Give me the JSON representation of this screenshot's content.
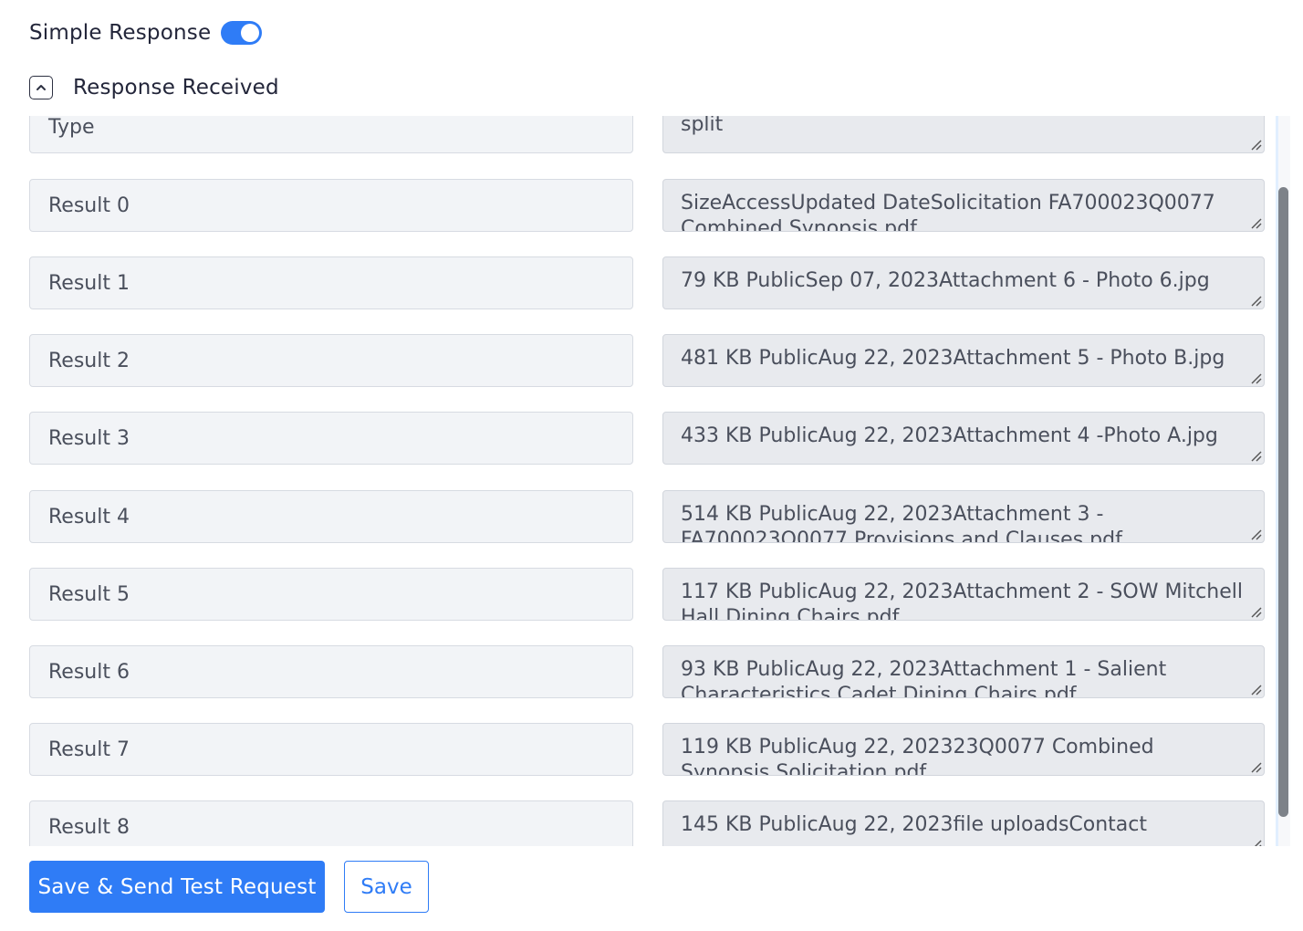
{
  "simple_response": {
    "label": "Simple Response",
    "enabled": true,
    "accent_color": "#2f7cf6"
  },
  "response_section": {
    "title": "Response Received",
    "collapse_icon": "chevron-up-icon"
  },
  "rows": [
    {
      "key": "Type",
      "value": "split"
    },
    {
      "key": "Result 0",
      "value": "SizeAccessUpdated DateSolicitation FA700023Q0077 Combined Synopsis.pdf"
    },
    {
      "key": "Result 1",
      "value": "79 KB PublicSep 07, 2023Attachment 6 - Photo 6.jpg"
    },
    {
      "key": "Result 2",
      "value": "481 KB PublicAug 22, 2023Attachment 5 - Photo B.jpg"
    },
    {
      "key": "Result 3",
      "value": "433 KB PublicAug 22, 2023Attachment 4 -Photo A.jpg"
    },
    {
      "key": "Result 4",
      "value": "514 KB PublicAug 22, 2023Attachment 3 - FA700023Q0077 Provisions and Clauses.pdf"
    },
    {
      "key": "Result 5",
      "value": "117 KB PublicAug 22, 2023Attachment 2 - SOW Mitchell Hall Dining Chairs.pdf"
    },
    {
      "key": "Result 6",
      "value": "93 KB PublicAug 22, 2023Attachment 1 - Salient Characteristics Cadet Dining Chairs.pdf"
    },
    {
      "key": "Result 7",
      "value": "119 KB PublicAug 22, 202323Q0077 Combined Synopsis Solicitation.pdf"
    },
    {
      "key": "Result 8",
      "value": "145 KB PublicAug 22, 2023file uploadsContact"
    }
  ],
  "footer": {
    "primary_label": "Save & Send Test Request",
    "secondary_label": "Save"
  }
}
